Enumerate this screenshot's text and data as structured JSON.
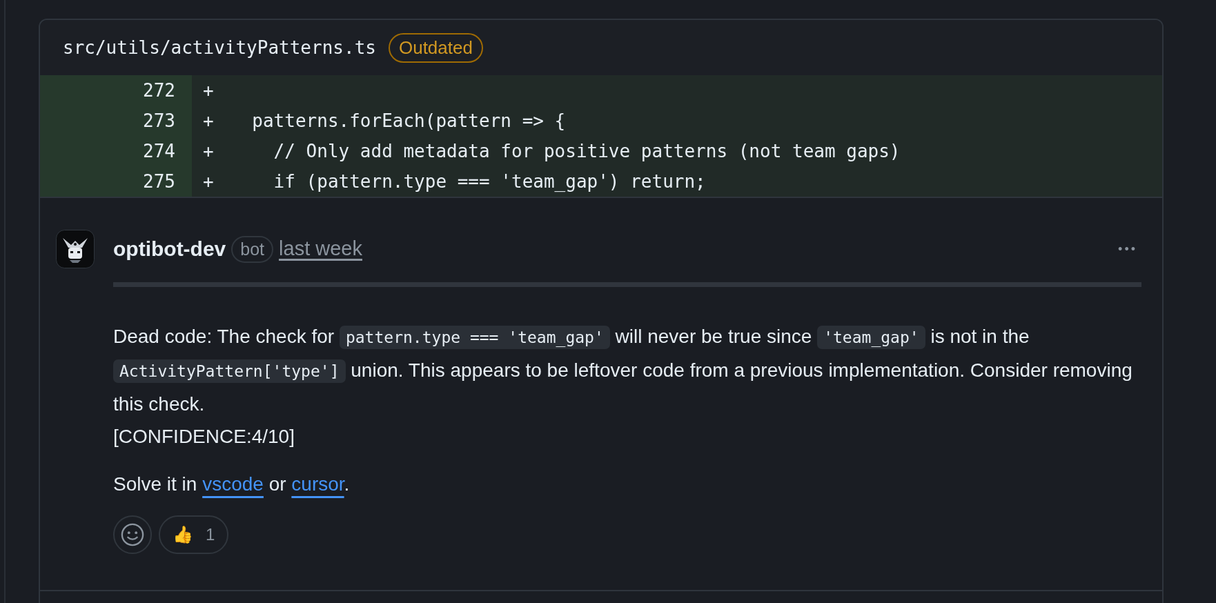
{
  "file": {
    "path": "src/utils/activityPatterns.ts",
    "badge": "Outdated"
  },
  "diff": [
    {
      "line": "272",
      "sign": "+"
    },
    {
      "line": "273",
      "sign": "+",
      "code": "  patterns.forEach(pattern => {"
    },
    {
      "line": "274",
      "sign": "+",
      "code": "    // Only add metadata for positive patterns (not team gaps)"
    },
    {
      "line": "275",
      "sign": "+",
      "code": "    if (pattern.type === 'team_gap') return;"
    }
  ],
  "comment": {
    "author": "optibot-dev",
    "author_badge": "bot",
    "time": "last week",
    "menu": "•••",
    "paragraphs": [
      [
        {
          "kind": "text",
          "text": "Dead code: The check for "
        },
        {
          "kind": "code",
          "text": "pattern.type === 'team_gap'"
        },
        {
          "kind": "text",
          "text": " will never be true since "
        },
        {
          "kind": "code",
          "text": "'team_gap'"
        },
        {
          "kind": "text",
          "text": " is not in the "
        },
        {
          "kind": "code",
          "text": "ActivityPattern['type']"
        },
        {
          "kind": "text",
          "text": " union. This appears to be leftover code from a previous implementation. Consider removing this check."
        },
        {
          "kind": "break"
        },
        {
          "kind": "text",
          "text": "[CONFIDENCE:4/10]"
        }
      ],
      [
        {
          "kind": "text",
          "text": "Solve it in "
        },
        {
          "kind": "link",
          "text": "vscode"
        },
        {
          "kind": "text",
          "text": " or "
        },
        {
          "kind": "link",
          "text": "cursor"
        },
        {
          "kind": "text",
          "text": "."
        }
      ]
    ],
    "reactions": [
      {
        "emoji": "👍",
        "count": "1"
      }
    ]
  }
}
